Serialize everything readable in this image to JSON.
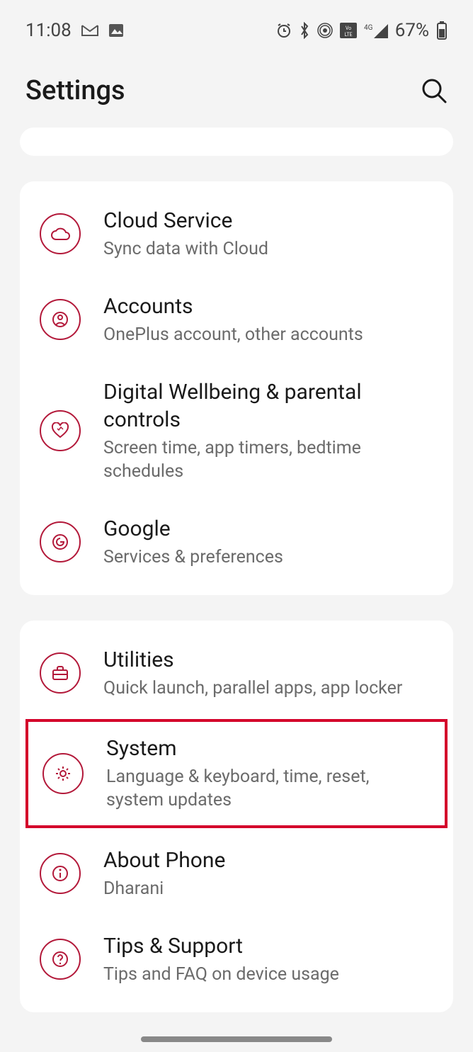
{
  "status": {
    "time": "11:08",
    "battery": "67%",
    "network": "4G"
  },
  "header": {
    "title": "Settings"
  },
  "groups": [
    {
      "items": [
        {
          "title": "Cloud Service",
          "subtitle": "Sync data with Cloud"
        },
        {
          "title": "Accounts",
          "subtitle": "OnePlus account, other accounts"
        },
        {
          "title": "Digital Wellbeing & parental controls",
          "subtitle": "Screen time, app timers, bedtime schedules"
        },
        {
          "title": "Google",
          "subtitle": "Services & preferences"
        }
      ]
    },
    {
      "items": [
        {
          "title": "Utilities",
          "subtitle": "Quick launch, parallel apps, app locker"
        },
        {
          "title": "System",
          "subtitle": "Language & keyboard, time, reset, system updates"
        },
        {
          "title": "About Phone",
          "subtitle": "Dharani"
        },
        {
          "title": "Tips & Support",
          "subtitle": "Tips and FAQ on device usage"
        }
      ]
    }
  ],
  "colors": {
    "accent": "#b3193a",
    "highlight": "#d4002a",
    "background": "#f4f4f4",
    "card": "#ffffff",
    "text": "#1a1a1a",
    "subtext": "#6b6b6b"
  }
}
